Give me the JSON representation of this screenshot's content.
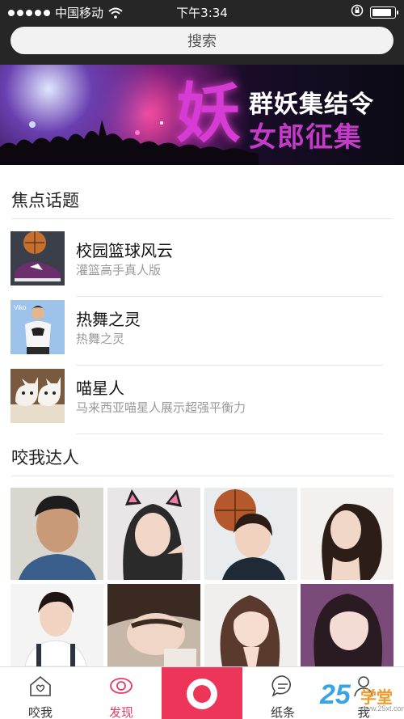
{
  "status_bar": {
    "carrier": "中国移动",
    "time": "下午3:34",
    "battery_level": 0.95
  },
  "search": {
    "placeholder": "搜索"
  },
  "banner": {
    "big_char": "妖",
    "line1": "群妖集结令",
    "line2": "女郎征集"
  },
  "focus": {
    "title": "焦点话题",
    "topics": [
      {
        "title": "校园篮球风云",
        "subtitle": "灌篮高手真人版",
        "icon": "sneaker-photo"
      },
      {
        "title": "热舞之灵",
        "subtitle": "热舞之灵",
        "icon": "dancer-photo"
      },
      {
        "title": "喵星人",
        "subtitle": "马来西亚喵星人展示超强平衡力",
        "icon": "kittens-photo"
      }
    ]
  },
  "experts": {
    "title": "咬我达人",
    "photos": [
      "portrait-man",
      "portrait-cat-ears",
      "portrait-basketball",
      "portrait-long-hair",
      "portrait-overalls",
      "portrait-bangs",
      "portrait-pose",
      "portrait-purple"
    ]
  },
  "tabbar": {
    "items": [
      {
        "label": "咬我",
        "icon": "home-icon"
      },
      {
        "label": "发现",
        "icon": "eye-icon",
        "active": true
      },
      {
        "label": "",
        "icon": "record-icon"
      },
      {
        "label": "纸条",
        "icon": "chat-bubble-icon"
      },
      {
        "label": "我",
        "icon": "person-icon"
      }
    ]
  },
  "watermark": {
    "number": "25",
    "text": "学堂",
    "url": "www.25xt.com"
  },
  "colors": {
    "accent": "#ec3559",
    "dark_header": "#262626"
  }
}
